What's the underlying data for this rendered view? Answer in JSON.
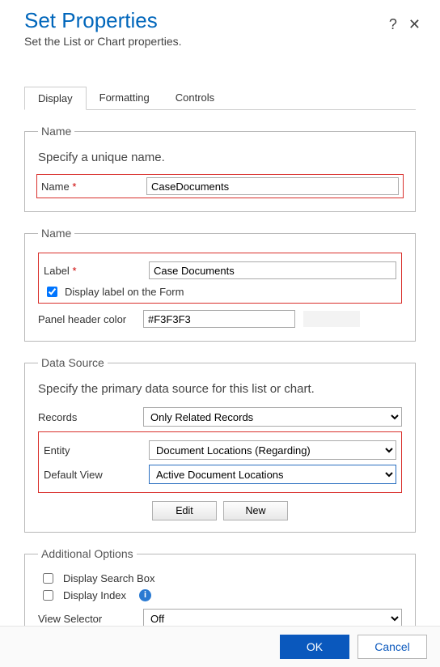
{
  "header": {
    "title": "Set Properties",
    "subtitle": "Set the List or Chart properties."
  },
  "tabs": {
    "display": "Display",
    "formatting": "Formatting",
    "controls": "Controls"
  },
  "section_name": {
    "legend": "Name",
    "hint": "Specify a unique name.",
    "name_label": "Name",
    "name_value": "CaseDocuments"
  },
  "section_label": {
    "legend": "Name",
    "label_label": "Label",
    "label_value": "Case Documents",
    "display_label_check": "Display label on the Form",
    "panel_color_label": "Panel header color",
    "panel_color_value": "#F3F3F3"
  },
  "section_ds": {
    "legend": "Data Source",
    "hint": "Specify the primary data source for this list or chart.",
    "records_label": "Records",
    "records_value": "Only Related Records",
    "entity_label": "Entity",
    "entity_value": "Document Locations (Regarding)",
    "defview_label": "Default View",
    "defview_value": "Active Document Locations",
    "edit": "Edit",
    "new": "New"
  },
  "section_add": {
    "legend": "Additional Options",
    "search_box": "Display Search Box",
    "display_index": "Display Index",
    "view_selector_label": "View Selector",
    "view_selector_value": "Off"
  },
  "footer": {
    "ok": "OK",
    "cancel": "Cancel"
  }
}
